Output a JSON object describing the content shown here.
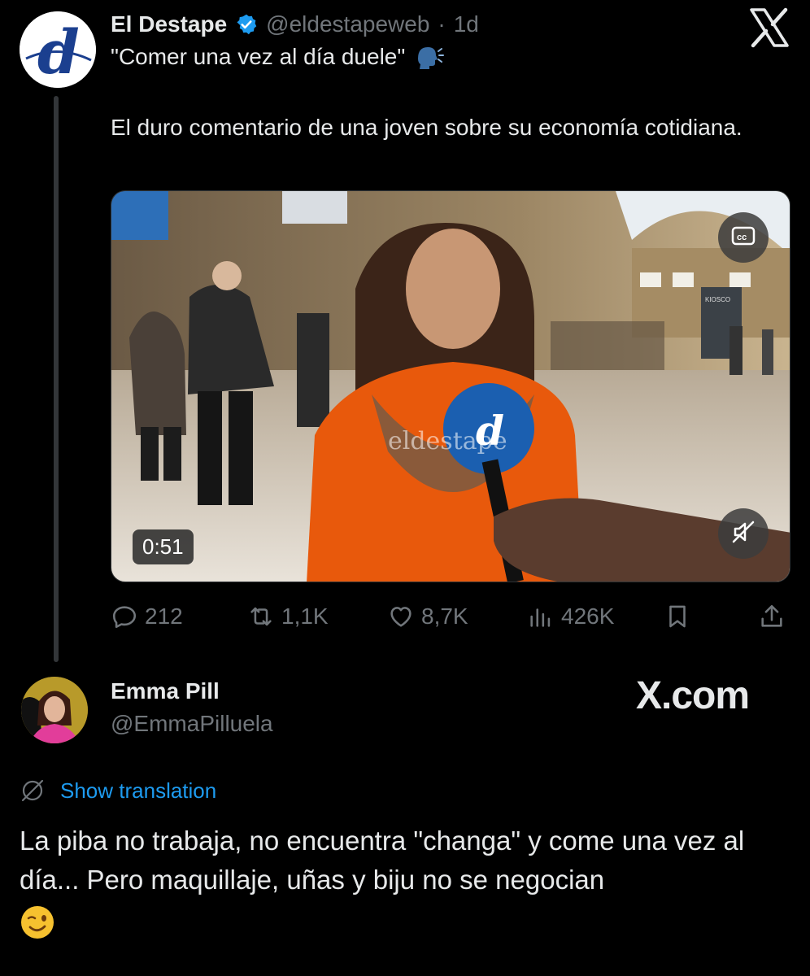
{
  "tweet": {
    "author_name": "El Destape",
    "author_handle": "@eldestapeweb",
    "time_ago": "1d",
    "line1": "\"Comer una vez al día duele\"",
    "paragraph": "El duro comentario de una joven sobre su economía cotidiana.",
    "video": {
      "duration": "0:51",
      "watermark": "eldestape",
      "kiosk_sign": "KIOSCO"
    },
    "actions": {
      "replies": "212",
      "reposts": "1,1K",
      "likes": "8,7K",
      "views": "426K"
    },
    "icons": [
      "verified-badge-icon",
      "speaking-head-icon",
      "x-logo-icon",
      "closed-captions-icon",
      "mute-icon",
      "reply-icon",
      "repost-icon",
      "like-icon",
      "views-icon",
      "bookmark-icon",
      "share-icon",
      "translate-icon"
    ]
  },
  "reply": {
    "author_name": "Emma Pill",
    "author_handle": "@EmmaPilluela",
    "watermark": "X.com",
    "show_translation": "Show translation",
    "text": "La piba no trabaja, no encuentra \"changa\" y come una vez al día... Pero maquillaje, uñas y biju no se negocian"
  },
  "colors": {
    "background": "#000000",
    "text": "#e7e9ea",
    "muted": "#71767b",
    "link": "#1d9bf0",
    "verified": "#1d9bf0",
    "brand_destape": "#1b3f8f"
  }
}
